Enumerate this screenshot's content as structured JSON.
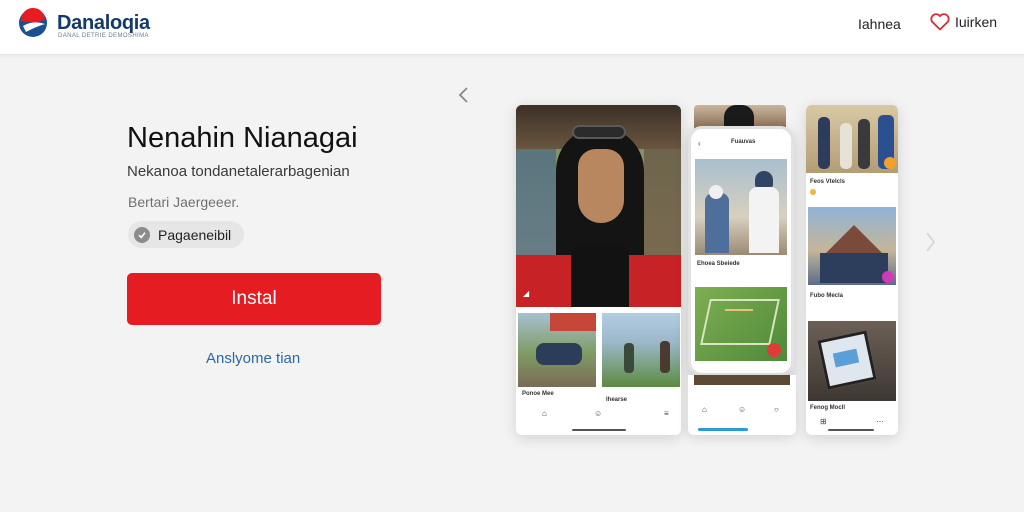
{
  "header": {
    "brand_name": "Danaloqia",
    "brand_tagline": "DANAL DETRIE DEMOSHIMA",
    "nav_link": "Iahnea",
    "favorite_label": "Iuirken"
  },
  "promo": {
    "title": "Nenahin Nianagai",
    "subtitle": "Nekanoa tondanetalerarbagenian",
    "meta": "Bertari Jaergeeer.",
    "chip_label": "Pagaeneibil",
    "install_label": "Instal",
    "secondary_link": "Anslyome tian"
  },
  "gallery": {
    "phone_header": "Fuauvas",
    "phone_caption": "Ehoea Sbeiede",
    "left_caption_1": "Ponoe Mee",
    "left_caption_2": "Ihearse",
    "right_caption_1": "Feos Vtelcls",
    "right_caption_2": "Fubo Mecla",
    "right_caption_3": "Fenog Mocll"
  },
  "colors": {
    "accent": "#e51d22",
    "brand": "#123a6b",
    "link": "#2a6aa6"
  }
}
